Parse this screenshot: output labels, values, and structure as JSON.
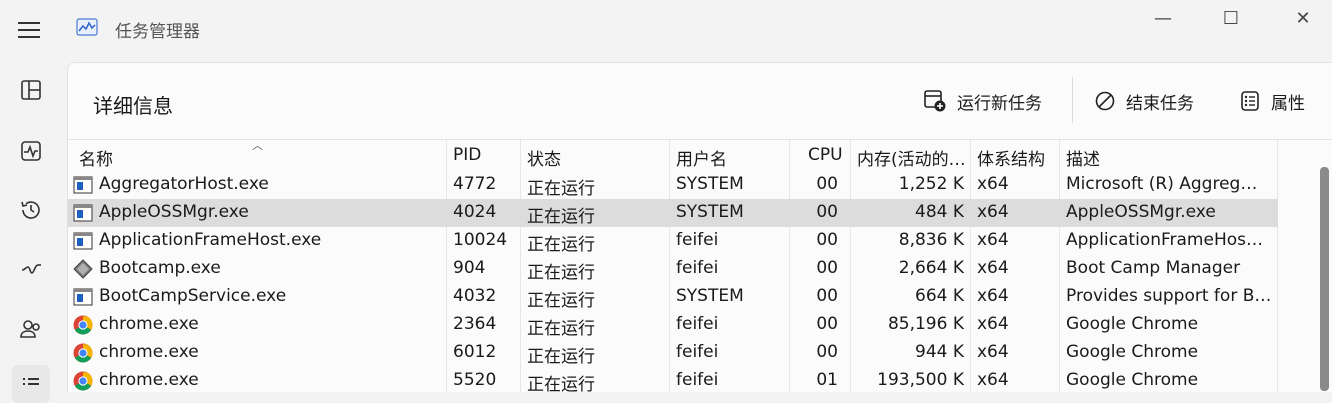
{
  "window": {
    "title": "任务管理器",
    "controls": {
      "minimize": "—",
      "maximize": "☐",
      "close": "✕"
    }
  },
  "nav": {
    "items": [
      {
        "name": "processes",
        "icon": "grid-icon"
      },
      {
        "name": "performance",
        "icon": "pulse-icon"
      },
      {
        "name": "app-history",
        "icon": "history-icon"
      },
      {
        "name": "startup",
        "icon": "startup-icon"
      },
      {
        "name": "users",
        "icon": "users-icon"
      },
      {
        "name": "details",
        "icon": "list-icon",
        "active": true
      }
    ]
  },
  "page": {
    "title": "详细信息",
    "toolbar": {
      "run_new_task": "运行新任务",
      "end_task": "结束任务",
      "properties": "属性"
    }
  },
  "table": {
    "headers": {
      "name": "名称",
      "pid": "PID",
      "status": "状态",
      "user": "用户名",
      "cpu": "CPU",
      "memory": "内存(活动的…",
      "arch": "体系结构",
      "desc": "描述"
    },
    "rows": [
      {
        "icon": "app-window-icon",
        "name": "AggregatorHost.exe",
        "pid": "4772",
        "status": "正在运行",
        "user": "SYSTEM",
        "cpu": "00",
        "memory": "1,252 K",
        "arch": "x64",
        "desc": "Microsoft (R) Aggreg…"
      },
      {
        "icon": "app-window-icon",
        "name": "AppleOSSMgr.exe",
        "pid": "4024",
        "status": "正在运行",
        "user": "SYSTEM",
        "cpu": "00",
        "memory": "484 K",
        "arch": "x64",
        "desc": "AppleOSSMgr.exe",
        "selected": true
      },
      {
        "icon": "app-window-icon",
        "name": "ApplicationFrameHost.exe",
        "pid": "10024",
        "status": "正在运行",
        "user": "feifei",
        "cpu": "00",
        "memory": "8,836 K",
        "arch": "x64",
        "desc": "ApplicationFrameHos…"
      },
      {
        "icon": "bootcamp-icon",
        "name": "Bootcamp.exe",
        "pid": "904",
        "status": "正在运行",
        "user": "feifei",
        "cpu": "00",
        "memory": "2,664 K",
        "arch": "x64",
        "desc": "Boot Camp Manager"
      },
      {
        "icon": "app-window-icon",
        "name": "BootCampService.exe",
        "pid": "4032",
        "status": "正在运行",
        "user": "SYSTEM",
        "cpu": "00",
        "memory": "664 K",
        "arch": "x64",
        "desc": "Provides support for B…"
      },
      {
        "icon": "chrome-icon",
        "name": "chrome.exe",
        "pid": "2364",
        "status": "正在运行",
        "user": "feifei",
        "cpu": "00",
        "memory": "85,196 K",
        "arch": "x64",
        "desc": "Google Chrome"
      },
      {
        "icon": "chrome-icon",
        "name": "chrome.exe",
        "pid": "6012",
        "status": "正在运行",
        "user": "feifei",
        "cpu": "00",
        "memory": "944 K",
        "arch": "x64",
        "desc": "Google Chrome"
      },
      {
        "icon": "chrome-icon",
        "name": "chrome.exe",
        "pid": "5520",
        "status": "正在运行",
        "user": "feifei",
        "cpu": "01",
        "memory": "193,500 K",
        "arch": "x64",
        "desc": "Google Chrome"
      }
    ]
  },
  "colors": {
    "background": "#f3f3f3",
    "panel": "#fbfbfb",
    "selected_row": "#dcdcdc",
    "chrome_red": "#db4437",
    "chrome_yellow": "#f4b400",
    "chrome_green": "#0f9d58",
    "chrome_blue": "#4285f4",
    "exe_icon_blue": "#1e5fbf"
  }
}
